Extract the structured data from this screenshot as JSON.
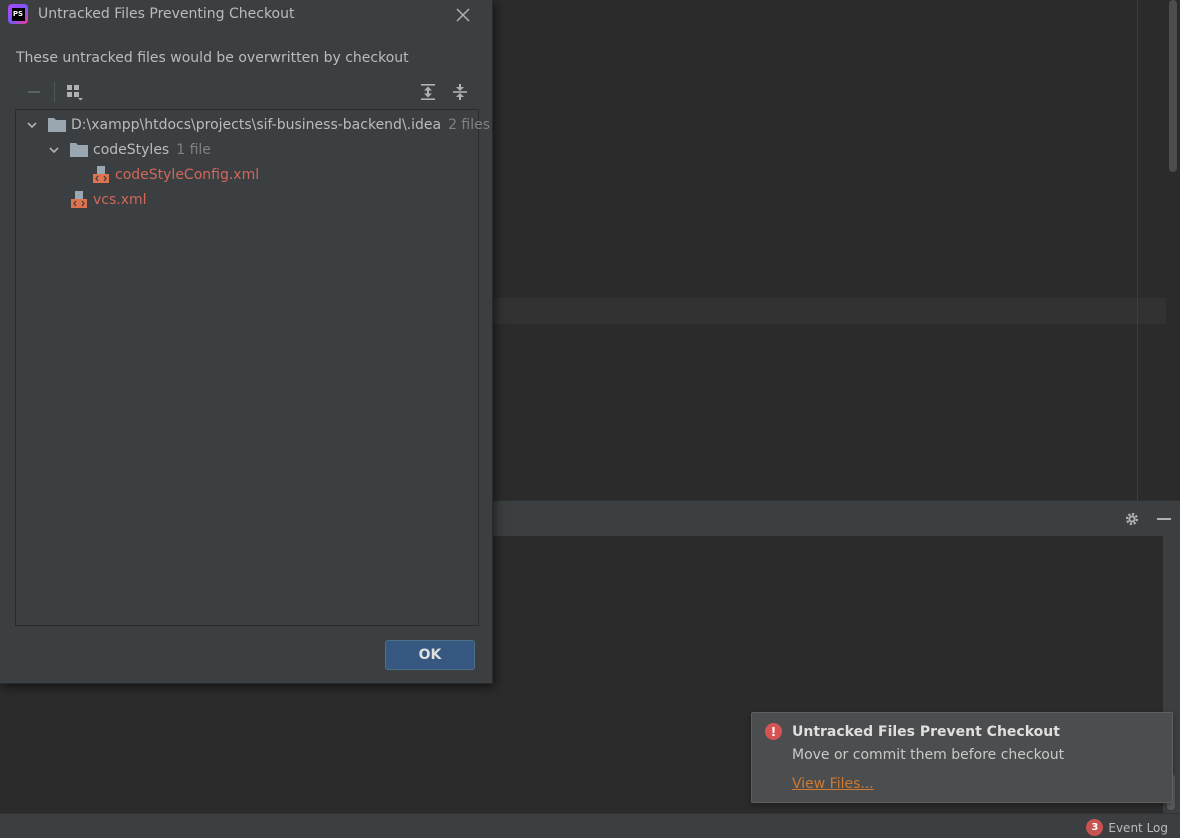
{
  "dialog": {
    "title": "Untracked Files Preventing Checkout",
    "message": "These untracked files would be overwritten by checkout",
    "ok_label": "OK"
  },
  "toolbar": {
    "remove_icon": "minus-icon",
    "group_icon": "group-by-icon",
    "expand_icon": "expand-all-icon",
    "collapse_icon": "collapse-all-icon"
  },
  "tree": {
    "root": {
      "label": "D:\\xampp\\htdocs\\projects\\sif-business-backend\\.idea",
      "count": "2 files"
    },
    "folder": {
      "label": "codeStyles",
      "count": "1 file"
    },
    "files": [
      {
        "label": "codeStyleConfig.xml"
      },
      {
        "label": "vcs.xml"
      }
    ]
  },
  "notification": {
    "title": "Untracked Files Prevent Checkout",
    "text": "Move or commit them before checkout",
    "link": "View Files..."
  },
  "statusbar": {
    "event_count": "3",
    "event_log_label": "Event Log"
  },
  "colors": {
    "dialog_bg": "#3c3f41",
    "editor_bg": "#2b2b2b",
    "untracked_file": "#d1675a",
    "ok_button": "#365880",
    "link": "#cc7832",
    "error": "#d55353"
  }
}
